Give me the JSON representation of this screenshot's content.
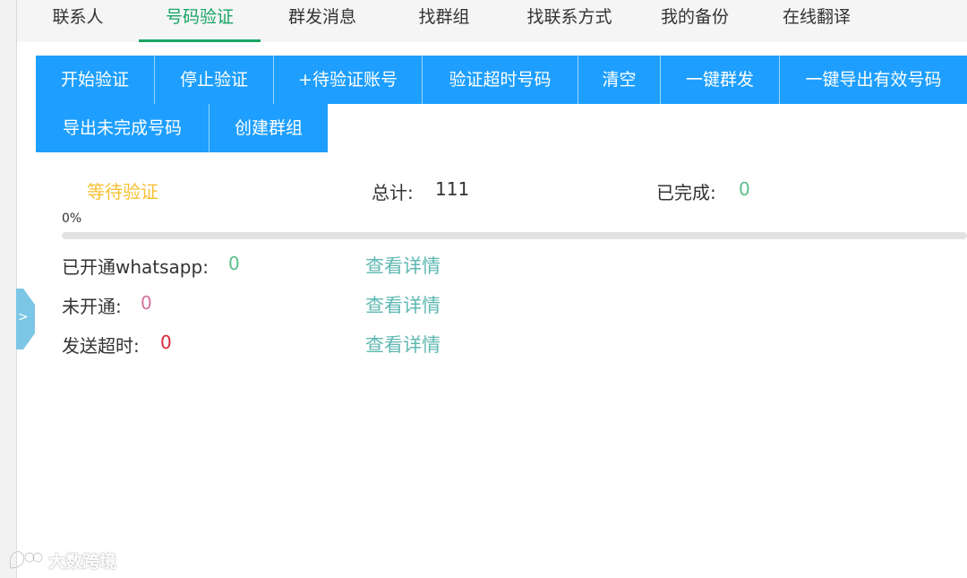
{
  "tabs": [
    {
      "label": "联系人",
      "active": false
    },
    {
      "label": "号码验证",
      "active": true
    },
    {
      "label": "群发消息",
      "active": false
    },
    {
      "label": "找群组",
      "active": false
    },
    {
      "label": "找联系方式",
      "active": false
    },
    {
      "label": "我的备份",
      "active": false
    },
    {
      "label": "在线翻译",
      "active": false
    }
  ],
  "toolbar": {
    "start_verify": "开始验证",
    "stop_verify": "停止验证",
    "add_accounts": "+待验证账号",
    "timeout_numbers": "验证超时号码",
    "clear": "清空",
    "bulk_send": "一键群发",
    "export_valid": "一键导出有效号码",
    "export_unfinished": "导出未完成号码",
    "create_group": "创建群组"
  },
  "summary": {
    "status": "等待验证",
    "total_label": "总计:",
    "total_value": "111",
    "done_label": "已完成:",
    "done_value": "0"
  },
  "progress": {
    "label": "0%",
    "value": 0
  },
  "results": [
    {
      "label": "已开通whatsapp:",
      "value": "0",
      "link": "查看详情",
      "value_color": "#5bbf8a"
    },
    {
      "label": "未开通:",
      "value": "0",
      "link": "查看详情",
      "value_color": "#d4719a"
    },
    {
      "label": "发送超时:",
      "value": "0",
      "link": "查看详情",
      "value_color": "#dc2a3a"
    }
  ],
  "side_toggle_glyph": ">",
  "watermark": "大数跨境",
  "colors": {
    "accent": "#1e9fff",
    "active_tab": "#18a565",
    "status": "#f5c033",
    "done_value": "#5bbf8a",
    "link": "#5fb8b3"
  },
  "icons": {
    "side_toggle": "chevron-right-icon",
    "watermark_logo": "chat-bubble-logo-icon"
  }
}
